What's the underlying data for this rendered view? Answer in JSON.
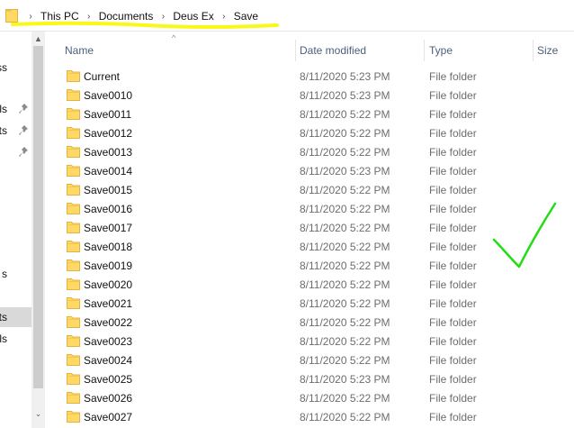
{
  "address_bar": {
    "breadcrumbs": [
      "This PC",
      "Documents",
      "Deus Ex",
      "Save"
    ],
    "separator": "›",
    "highlight_color": "#f7f700"
  },
  "navigation": {
    "items": [
      {
        "label": "ss",
        "pinned": false,
        "selected": false
      },
      {
        "label": "ls",
        "pinned": true,
        "selected": false
      },
      {
        "label": "ts",
        "pinned": true,
        "selected": false
      },
      {
        "label": "",
        "pinned": true,
        "selected": false
      },
      {
        "label": "s",
        "pinned": false,
        "selected": false
      },
      {
        "label": "ts",
        "pinned": false,
        "selected": true
      },
      {
        "label": "ls",
        "pinned": false,
        "selected": false
      }
    ]
  },
  "columns": {
    "name": "Name",
    "date_modified": "Date modified",
    "type": "Type",
    "size": "Size",
    "sort_indicator": "^"
  },
  "files": [
    {
      "name": "Current",
      "date": "8/11/2020 5:23 PM",
      "type": "File folder"
    },
    {
      "name": "Save0010",
      "date": "8/11/2020 5:23 PM",
      "type": "File folder"
    },
    {
      "name": "Save0011",
      "date": "8/11/2020 5:22 PM",
      "type": "File folder"
    },
    {
      "name": "Save0012",
      "date": "8/11/2020 5:22 PM",
      "type": "File folder"
    },
    {
      "name": "Save0013",
      "date": "8/11/2020 5:22 PM",
      "type": "File folder"
    },
    {
      "name": "Save0014",
      "date": "8/11/2020 5:23 PM",
      "type": "File folder"
    },
    {
      "name": "Save0015",
      "date": "8/11/2020 5:22 PM",
      "type": "File folder"
    },
    {
      "name": "Save0016",
      "date": "8/11/2020 5:22 PM",
      "type": "File folder"
    },
    {
      "name": "Save0017",
      "date": "8/11/2020 5:22 PM",
      "type": "File folder"
    },
    {
      "name": "Save0018",
      "date": "8/11/2020 5:22 PM",
      "type": "File folder"
    },
    {
      "name": "Save0019",
      "date": "8/11/2020 5:22 PM",
      "type": "File folder"
    },
    {
      "name": "Save0020",
      "date": "8/11/2020 5:22 PM",
      "type": "File folder"
    },
    {
      "name": "Save0021",
      "date": "8/11/2020 5:22 PM",
      "type": "File folder"
    },
    {
      "name": "Save0022",
      "date": "8/11/2020 5:22 PM",
      "type": "File folder"
    },
    {
      "name": "Save0023",
      "date": "8/11/2020 5:22 PM",
      "type": "File folder"
    },
    {
      "name": "Save0024",
      "date": "8/11/2020 5:22 PM",
      "type": "File folder"
    },
    {
      "name": "Save0025",
      "date": "8/11/2020 5:23 PM",
      "type": "File folder"
    },
    {
      "name": "Save0026",
      "date": "8/11/2020 5:22 PM",
      "type": "File folder"
    },
    {
      "name": "Save0027",
      "date": "8/11/2020 5:22 PM",
      "type": "File folder"
    }
  ],
  "annotation": {
    "checkmark_color": "#22dd11"
  },
  "colors": {
    "folder_yellow": "#ffd866",
    "folder_edge": "#e0b43f",
    "header_text": "#4c607a",
    "secondary_text": "#6d6d6d"
  }
}
